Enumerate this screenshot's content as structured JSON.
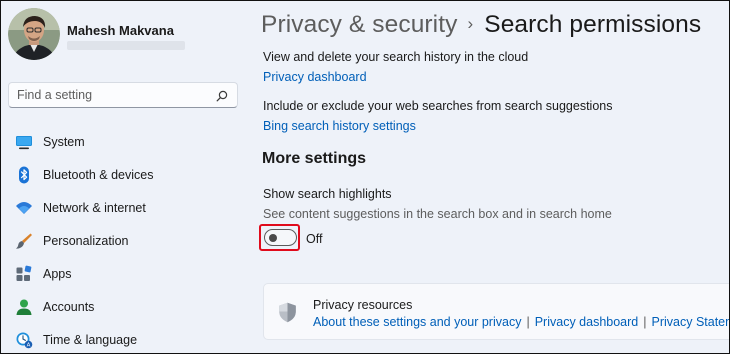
{
  "user": {
    "name": "Mahesh Makvana"
  },
  "search": {
    "placeholder": "Find a setting"
  },
  "sidebar": {
    "items": [
      {
        "label": "System",
        "icon": "system-icon"
      },
      {
        "label": "Bluetooth & devices",
        "icon": "bluetooth-icon"
      },
      {
        "label": "Network & internet",
        "icon": "network-icon"
      },
      {
        "label": "Personalization",
        "icon": "personalization-icon"
      },
      {
        "label": "Apps",
        "icon": "apps-icon"
      },
      {
        "label": "Accounts",
        "icon": "accounts-icon"
      },
      {
        "label": "Time & language",
        "icon": "time-language-icon"
      }
    ]
  },
  "header": {
    "parent": "Privacy & security",
    "separator": "›",
    "current": "Search permissions"
  },
  "main": {
    "history_text": "View and delete your search history in the cloud",
    "privacy_dashboard_link": "Privacy dashboard",
    "bing_text": "Include or exclude your web searches from search suggestions",
    "bing_link": "Bing search history settings",
    "more_settings_heading": "More settings",
    "highlights_title": "Show search highlights",
    "highlights_desc": "See content suggestions in the search box and in search home",
    "highlights_toggle": {
      "state": "Off",
      "on": false
    }
  },
  "privacy_card": {
    "title": "Privacy resources",
    "links": [
      "About these settings and your privacy",
      "Privacy dashboard",
      "Privacy Statement"
    ],
    "separator": "|"
  },
  "colors": {
    "accent_link": "#005fb8",
    "highlight_box": "#e00b1c",
    "background": "#eef2f9"
  }
}
